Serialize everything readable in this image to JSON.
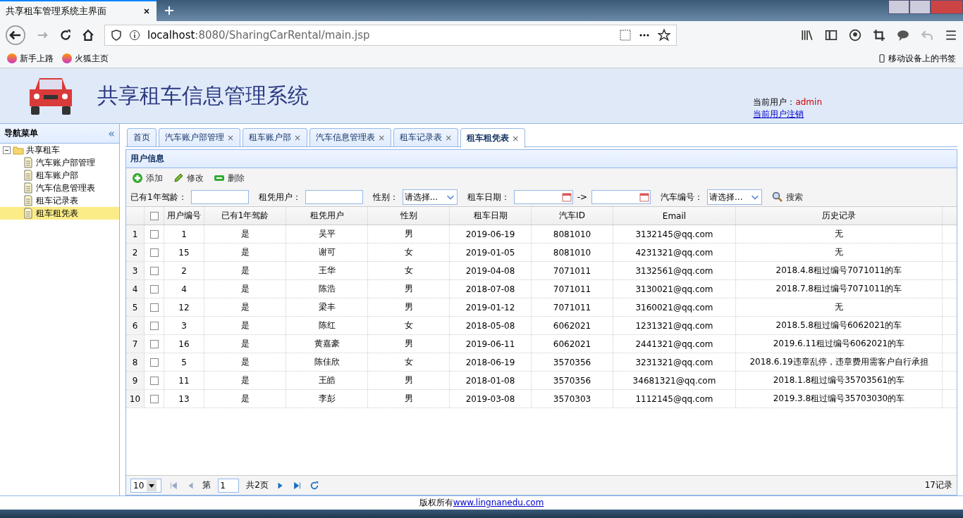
{
  "browser": {
    "tab_title": "共享租车管理系统主界面",
    "url_host": "localhost",
    "url_rest": ":8080/SharingCarRental/main.jsp",
    "bookmarks": [
      "新手上路",
      "火狐主页"
    ],
    "mobile_bookmarks": "移动设备上的书签"
  },
  "header": {
    "title": "共享租车信息管理系统",
    "user_label": "当前用户：",
    "user_name": "admin",
    "logout": "当前用户注销"
  },
  "sidebar": {
    "title": "导航菜单",
    "collapse": "«",
    "root": {
      "label": "共享租车",
      "expanded": true,
      "children": [
        {
          "label": "汽车账户部管理",
          "selected": false
        },
        {
          "label": "租车账户部",
          "selected": false
        },
        {
          "label": "汽车信息管理表",
          "selected": false
        },
        {
          "label": "租车记录表",
          "selected": false
        },
        {
          "label": "租车租凭表",
          "selected": true
        }
      ]
    }
  },
  "tabs": [
    {
      "label": "首页",
      "closable": false,
      "selected": false
    },
    {
      "label": "汽车账户部管理",
      "closable": true,
      "selected": false
    },
    {
      "label": "租车账户部",
      "closable": true,
      "selected": false
    },
    {
      "label": "汽车信息管理表",
      "closable": true,
      "selected": false
    },
    {
      "label": "租车记录表",
      "closable": true,
      "selected": false
    },
    {
      "label": "租车租凭表",
      "closable": true,
      "selected": true
    }
  ],
  "close_glyph": "×",
  "panel": {
    "title": "用户信息",
    "toolbar": [
      {
        "kind": "add",
        "label": "添加"
      },
      {
        "kind": "edit",
        "label": "修改"
      },
      {
        "kind": "delete",
        "label": "删除"
      }
    ],
    "filters": [
      {
        "kind": "text",
        "label": "已有1年驾龄："
      },
      {
        "kind": "text",
        "label": "租凭用户："
      },
      {
        "kind": "select",
        "label": "性别：",
        "value": "请选择..."
      },
      {
        "kind": "daterange",
        "label": "租车日期：",
        "separator": "->"
      },
      {
        "kind": "select",
        "label": "汽车编号：",
        "value": "请选择..."
      }
    ],
    "search": "搜索"
  },
  "table": {
    "select_all_checked": false,
    "columns": [
      "用户编号",
      "已有1年驾龄",
      "租凭用户",
      "性别",
      "租车日期",
      "汽车ID",
      "Email",
      "历史记录"
    ],
    "rows": [
      {
        "n": "1",
        "checked": false,
        "cells": [
          "1",
          "是",
          "吴平",
          "男",
          "2019-06-19",
          "8081010",
          "3132145@qq.com",
          "无"
        ]
      },
      {
        "n": "2",
        "checked": false,
        "cells": [
          "15",
          "是",
          "谢可",
          "女",
          "2019-01-05",
          "8081010",
          "4231321@qq.com",
          "无"
        ]
      },
      {
        "n": "3",
        "checked": false,
        "cells": [
          "2",
          "是",
          "王华",
          "女",
          "2019-04-08",
          "7071011",
          "3132561@qq.com",
          "2018.4.8租过编号7071011的车"
        ]
      },
      {
        "n": "4",
        "checked": false,
        "cells": [
          "4",
          "是",
          "陈浩",
          "男",
          "2018-07-08",
          "7071011",
          "3130021@qq.com",
          "2018.7.8租过编号7071011的车"
        ]
      },
      {
        "n": "5",
        "checked": false,
        "cells": [
          "12",
          "是",
          "梁丰",
          "男",
          "2019-01-12",
          "7071011",
          "3160021@qq.com",
          "无"
        ]
      },
      {
        "n": "6",
        "checked": false,
        "cells": [
          "3",
          "是",
          "陈红",
          "女",
          "2018-05-08",
          "6062021",
          "1231321@qq.com",
          "2018.5.8租过编号6062021的车"
        ]
      },
      {
        "n": "7",
        "checked": false,
        "cells": [
          "16",
          "是",
          "黄嘉豪",
          "男",
          "2019-06-11",
          "6062021",
          "2441321@qq.com",
          "2019.6.11租过编号6062021的车"
        ]
      },
      {
        "n": "8",
        "checked": false,
        "cells": [
          "5",
          "是",
          "陈佳欣",
          "女",
          "2018-06-19",
          "3570356",
          "3231321@qq.com",
          "2018.6.19违章乱停，违章费用需客户自行承担"
        ]
      },
      {
        "n": "9",
        "checked": false,
        "cells": [
          "11",
          "是",
          "王皓",
          "男",
          "2018-01-08",
          "3570356",
          "34681321@qq.com",
          "2018.1.8租过编号35703561的车"
        ]
      },
      {
        "n": "10",
        "checked": false,
        "cells": [
          "13",
          "是",
          "李彭",
          "男",
          "2019-03-08",
          "3570303",
          "1112145@qq.com",
          "2019.3.8租过编号35703030的车"
        ]
      }
    ]
  },
  "pager": {
    "page_size": "10",
    "page_prefix": "第",
    "page": "1",
    "page_total": "共2页",
    "info": "17记录"
  },
  "footer": {
    "text": "版权所有",
    "link": "www.lingnanedu.com"
  }
}
